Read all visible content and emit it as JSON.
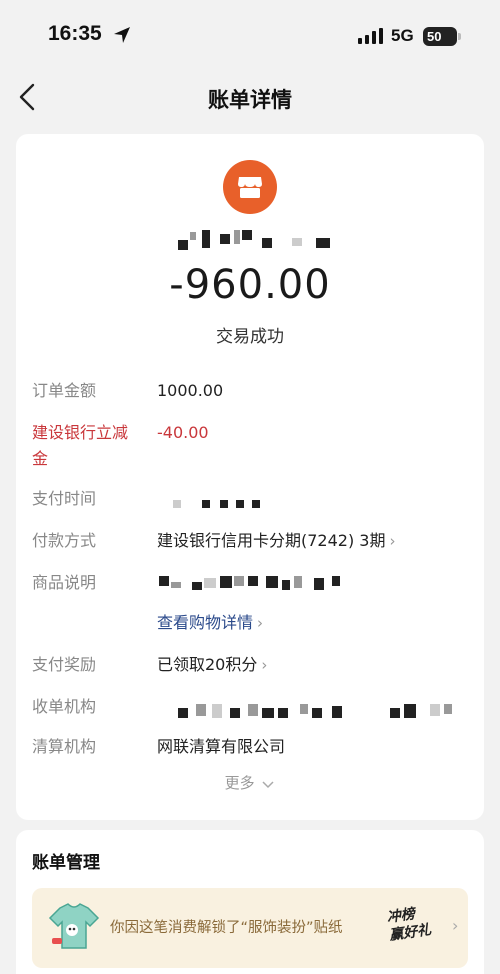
{
  "status_bar": {
    "time": "16:35",
    "network": "5G",
    "battery": "50"
  },
  "nav": {
    "title": "账单详情"
  },
  "bill": {
    "amount": "-960.00",
    "status": "交易成功",
    "rows": {
      "order_amount_label": "订单金额",
      "order_amount_value": "1000.00",
      "discount_label_1": "建设银行立减",
      "discount_label_2": "金",
      "discount_value": "-40.00",
      "pay_time_label": "支付时间",
      "pay_method_label": "付款方式",
      "pay_method_value": "建设银行信用卡分期(7242) 3期",
      "goods_label": "商品说明",
      "goods_link": "查看购物详情",
      "reward_label": "支付奖励",
      "reward_value": "已领取20积分",
      "acquirer_label": "收单机构",
      "clearing_label": "清算机构",
      "clearing_value": "网联清算有限公司"
    },
    "more": "更多"
  },
  "management": {
    "title": "账单管理",
    "promo_text": "你因这笔消费解锁了“服饰装扮”贴纸",
    "promo_badge_1": "冲榜",
    "promo_badge_2": "赢好礼"
  },
  "icons": {
    "back": "back-chevron-icon",
    "merchant": "store-icon",
    "location": "location-arrow-icon",
    "signal": "signal-bars-icon",
    "promo": "tshirt-sticker-icon"
  },
  "colors": {
    "accent": "#e8602a",
    "discount": "#c9373b",
    "link": "#2b4a8b",
    "promo_bg": "#f9f1e0"
  }
}
